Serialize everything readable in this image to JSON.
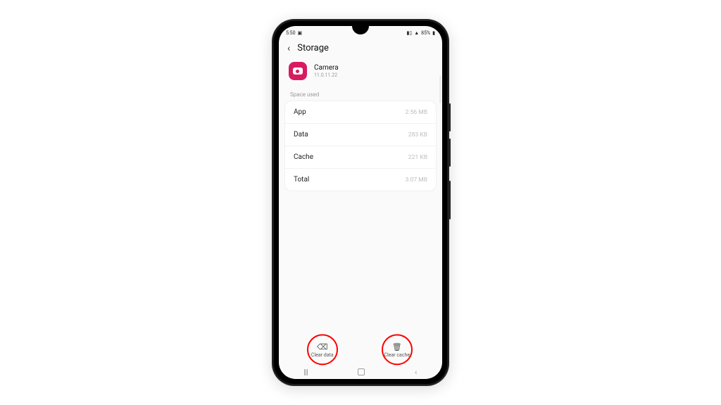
{
  "status": {
    "time": "5:50",
    "battery_text": "85%"
  },
  "header": {
    "title": "Storage"
  },
  "app": {
    "name": "Camera",
    "version": "11.0.11.22"
  },
  "section": {
    "space_used_label": "Space used"
  },
  "rows": {
    "app": {
      "label": "App",
      "value": "2.56 MB"
    },
    "data": {
      "label": "Data",
      "value": "283 KB"
    },
    "cache": {
      "label": "Cache",
      "value": "221 KB"
    },
    "total": {
      "label": "Total",
      "value": "3.07 MB"
    }
  },
  "actions": {
    "clear_data": "Clear data",
    "clear_cache": "Clear cache"
  }
}
